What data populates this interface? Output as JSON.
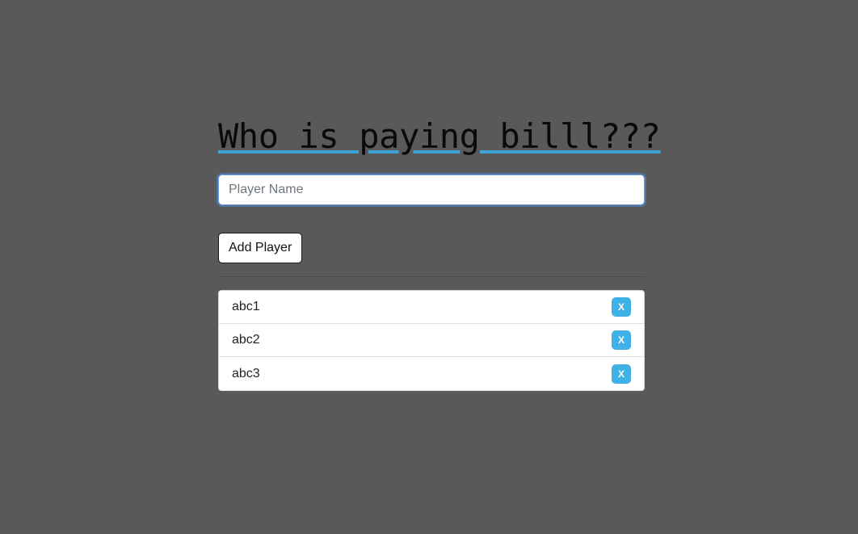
{
  "page": {
    "title": "Who is paying billl???"
  },
  "form": {
    "input_placeholder": "Player Name",
    "input_value": "",
    "add_button_label": "Add Player"
  },
  "players": [
    {
      "name": "abc1",
      "remove_label": "X"
    },
    {
      "name": "abc2",
      "remove_label": "X"
    },
    {
      "name": "abc3",
      "remove_label": "X"
    }
  ],
  "colors": {
    "background": "#595959",
    "accent": "#3fa3d6",
    "remove_button": "#3fb1e6"
  },
  "icons": {
    "remove": "close-icon"
  }
}
